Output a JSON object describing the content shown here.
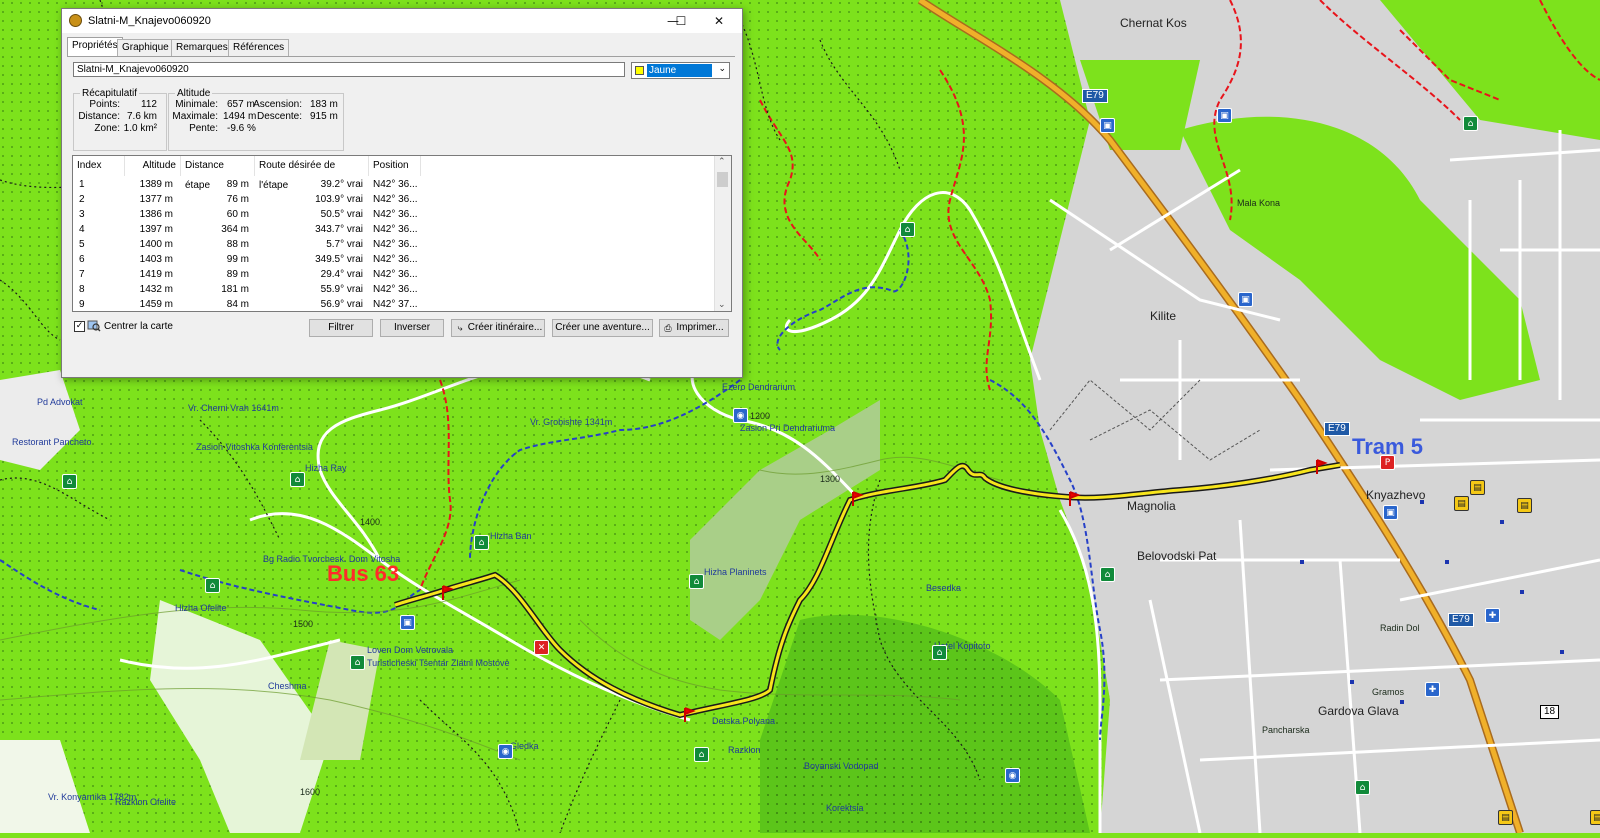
{
  "window": {
    "title": "Slatni-M_Knajevo060920",
    "minimize_glyph": "—",
    "maximize_glyph": "☐",
    "close_glyph": "✕"
  },
  "tabs": [
    "Propriétés",
    "Graphique",
    "Remarques",
    "Références"
  ],
  "name_input": {
    "value": "Slatni-M_Knajevo060920"
  },
  "color_select": {
    "value": "Jaune",
    "swatch": "#ffff00"
  },
  "recap": {
    "legend": "Récapitulatif",
    "points_label": "Points:",
    "points": "112",
    "distance_label": "Distance:",
    "distance": "7.6 km",
    "zone_label": "Zone:",
    "zone": "1.0 km²"
  },
  "altitude": {
    "legend": "Altitude",
    "min_label": "Minimale:",
    "min": "657 m",
    "max_label": "Maximale:",
    "max": "1494 m",
    "slope_label": "Pente:",
    "slope": "-9.6 %",
    "ascent_label": "Ascension:",
    "ascent": "183 m",
    "descent_label": "Descente:",
    "descent": "915 m"
  },
  "table": {
    "headers": [
      "Index",
      "Altitude",
      "Distance étape",
      "Route désirée de l'étape",
      "Position"
    ],
    "rows": [
      [
        "1",
        "1389 m",
        "89 m",
        "39.2° vrai",
        "N42° 36..."
      ],
      [
        "2",
        "1377 m",
        "76 m",
        "103.9° vrai",
        "N42° 36..."
      ],
      [
        "3",
        "1386 m",
        "60 m",
        "50.5° vrai",
        "N42° 36..."
      ],
      [
        "4",
        "1397 m",
        "364 m",
        "343.7° vrai",
        "N42° 36..."
      ],
      [
        "5",
        "1400 m",
        "88 m",
        "5.7° vrai",
        "N42° 36..."
      ],
      [
        "6",
        "1403 m",
        "99 m",
        "349.5° vrai",
        "N42° 36..."
      ],
      [
        "7",
        "1419 m",
        "89 m",
        "29.4° vrai",
        "N42° 36..."
      ],
      [
        "8",
        "1432 m",
        "181 m",
        "55.9° vrai",
        "N42° 36..."
      ],
      [
        "9",
        "1459 m",
        "84 m",
        "56.9° vrai",
        "N42° 37..."
      ]
    ]
  },
  "center_map": {
    "label": "Centrer la carte",
    "checked": true
  },
  "buttons": {
    "filter": "Filtrer",
    "reverse": "Inverser",
    "create_route": "Créer itinéraire...",
    "create_adventure": "Créer une aventure...",
    "print": "Imprimer..."
  },
  "map": {
    "labels": {
      "bus": "Bus 63",
      "tram": "Tram 5",
      "magnolia": "Magnolia",
      "knyazhevo": "Knyazhevo",
      "belovodski": "Belovodski Pat",
      "gardova": "Gardova Glava",
      "chernat": "Chernat Kos",
      "kilite": "Kilite",
      "radin": "Radin Dol",
      "pancharska": "Pancharska",
      "gramos": "Gramos",
      "mala_kona": "Mala Kona",
      "pod_advokat": "Pd Advokat",
      "restorant": "Restorant Pancheto",
      "vr_cherni": "Vr. Cherni Vrah 1641m",
      "zasl_vit": "Zasion Vitoshka Konferentsia",
      "hizha_ray": "Hizha Ray",
      "vr_grob": "Vr. Grobishte 1341m",
      "ezero": "Ezero Dendrarium",
      "zasl_dend": "Zasion Pri Dendrariuma",
      "hizha_ban": "Hizha Ban",
      "hizha_plan": "Hizha Planinets",
      "besedka": "Besedka",
      "hotel": "Hotel Kopitoto",
      "gledka": "Gledka",
      "boyanski": "Boyanski Vodopad",
      "korektsia": "Korektsia",
      "detska": "Detska Polyana",
      "razklon": "Razklon",
      "razklon_o": "Razklon Ofelite",
      "vr_kony": "Vr. Konyarnika 1782m",
      "hizha_of": "Hizha Ofelite",
      "vetrovala": "Loven Dom Vetrovala",
      "zlatni": "Turisticheski Tsentar Zlatni Mostove",
      "bg_radio": "Bg Radio Tvorchesk. Dom Vitosha",
      "chesma": "Cheshma",
      "e79": "E79",
      "r18": "18",
      "contour_1300": "1300",
      "contour_1400": "1400",
      "contour_1500": "1500",
      "contour_1600": "1600",
      "contour_1200": "1200"
    }
  }
}
